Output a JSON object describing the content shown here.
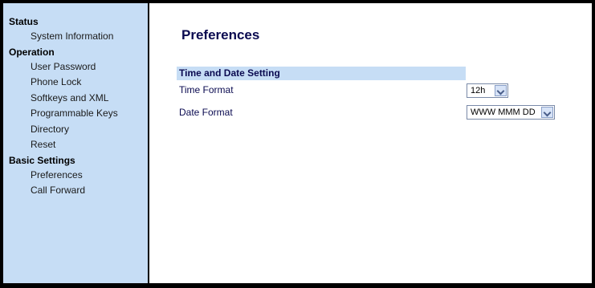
{
  "sidebar": {
    "sections": [
      {
        "label": "Status",
        "items": [
          "System Information"
        ]
      },
      {
        "label": "Operation",
        "items": [
          "User Password",
          "Phone Lock",
          "Softkeys and XML",
          "Programmable Keys",
          "Directory",
          "Reset"
        ]
      },
      {
        "label": "Basic Settings",
        "items": [
          "Preferences",
          "Call Forward"
        ]
      }
    ]
  },
  "main": {
    "title": "Preferences",
    "section_title": "Time and Date Setting",
    "time_format_label": "Time Format",
    "time_format_value": "12h",
    "date_format_label": "Date Format",
    "date_format_value": "WWW MMM DD"
  },
  "colors": {
    "sidebar_bg": "#c6ddf5",
    "title_text": "#0a0a50",
    "border": "#000000"
  }
}
